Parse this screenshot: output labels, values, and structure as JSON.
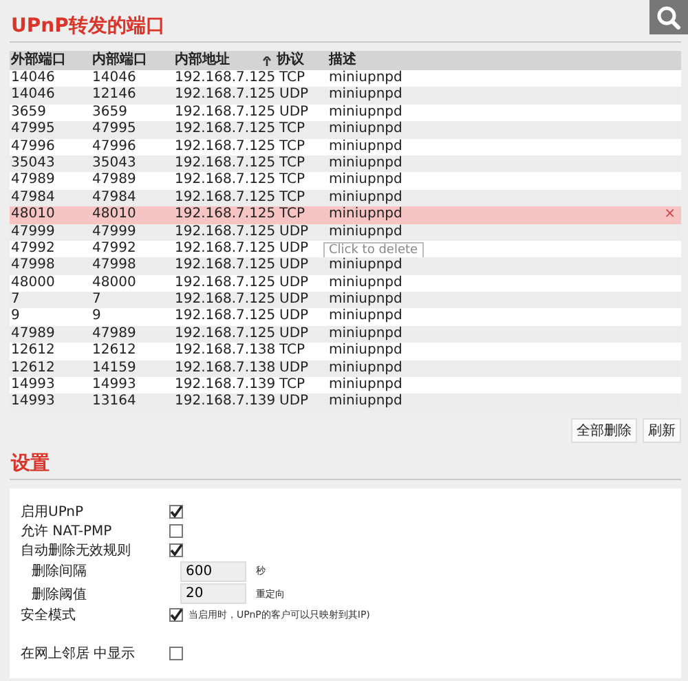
{
  "forwarded_ports": {
    "title": "UPnP转发的端口",
    "columns": [
      {
        "label": "外部端口",
        "sorted": false
      },
      {
        "label": "内部端口",
        "sorted": false
      },
      {
        "label": "内部地址",
        "sorted": true
      },
      {
        "label": "协议",
        "sorted": false
      },
      {
        "label": "描述",
        "sorted": false
      }
    ],
    "rows": [
      {
        "cells": [
          "14046",
          "14046",
          "192.168.7.125",
          "TCP",
          "miniupnpd"
        ],
        "selected": false
      },
      {
        "cells": [
          "14046",
          "12146",
          "192.168.7.125",
          "UDP",
          "miniupnpd"
        ],
        "selected": false
      },
      {
        "cells": [
          "3659",
          "3659",
          "192.168.7.125",
          "UDP",
          "miniupnpd"
        ],
        "selected": false
      },
      {
        "cells": [
          "47995",
          "47995",
          "192.168.7.125",
          "TCP",
          "miniupnpd"
        ],
        "selected": false
      },
      {
        "cells": [
          "47996",
          "47996",
          "192.168.7.125",
          "TCP",
          "miniupnpd"
        ],
        "selected": false
      },
      {
        "cells": [
          "35043",
          "35043",
          "192.168.7.125",
          "TCP",
          "miniupnpd"
        ],
        "selected": false
      },
      {
        "cells": [
          "47989",
          "47989",
          "192.168.7.125",
          "TCP",
          "miniupnpd"
        ],
        "selected": false
      },
      {
        "cells": [
          "47984",
          "47984",
          "192.168.7.125",
          "TCP",
          "miniupnpd"
        ],
        "selected": false
      },
      {
        "cells": [
          "48010",
          "48010",
          "192.168.7.125",
          "TCP",
          "miniupnpd"
        ],
        "selected": true,
        "delete": "×"
      },
      {
        "cells": [
          "47999",
          "47999",
          "192.168.7.125",
          "UDP",
          "miniupnpd"
        ],
        "selected": false
      },
      {
        "cells": [
          "47992",
          "47992",
          "192.168.7.125",
          "UDP"
        ],
        "selected": false,
        "tooltip": "Click to delete"
      },
      {
        "cells": [
          "47998",
          "47998",
          "192.168.7.125",
          "UDP",
          "miniupnpd"
        ],
        "selected": false
      },
      {
        "cells": [
          "48000",
          "48000",
          "192.168.7.125",
          "UDP",
          "miniupnpd"
        ],
        "selected": false
      },
      {
        "cells": [
          "7",
          "7",
          "192.168.7.125",
          "UDP",
          "miniupnpd"
        ],
        "selected": false
      },
      {
        "cells": [
          "9",
          "9",
          "192.168.7.125",
          "UDP",
          "miniupnpd"
        ],
        "selected": false
      },
      {
        "cells": [
          "47989",
          "47989",
          "192.168.7.125",
          "UDP",
          "miniupnpd"
        ],
        "selected": false
      },
      {
        "cells": [
          "12612",
          "12612",
          "192.168.7.138",
          "TCP",
          "miniupnpd"
        ],
        "selected": false
      },
      {
        "cells": [
          "12612",
          "14159",
          "192.168.7.138",
          "UDP",
          "miniupnpd"
        ],
        "selected": false
      },
      {
        "cells": [
          "14993",
          "14993",
          "192.168.7.139",
          "TCP",
          "miniupnpd"
        ],
        "selected": false
      },
      {
        "cells": [
          "14993",
          "13164",
          "192.168.7.139",
          "UDP",
          "miniupnpd"
        ],
        "selected": false
      }
    ],
    "buttons": [
      "全部删除",
      "刷新"
    ]
  },
  "settings": {
    "title": "设置",
    "items": [
      {
        "kind": "checkbox",
        "label": "启用UPnP",
        "checked": true
      },
      {
        "kind": "checkbox",
        "label": "允许 NAT-PMP",
        "checked": false
      },
      {
        "kind": "checkbox",
        "label": "自动删除无效规则",
        "checked": true,
        "children": [
          {
            "kind": "input",
            "label": "删除间隔",
            "value": "600",
            "unit": "秒"
          },
          {
            "kind": "input",
            "label": "删除阈值",
            "value": "20",
            "unit": "重定向"
          }
        ]
      },
      {
        "kind": "checkbox",
        "label": "安全模式",
        "checked": true,
        "note": "当启用时，UPnP的客户可以只映射到其IP)"
      },
      {
        "kind": "spacer"
      },
      {
        "kind": "checkbox",
        "label": "在网上邻居 中显示",
        "checked": false
      }
    ]
  }
}
